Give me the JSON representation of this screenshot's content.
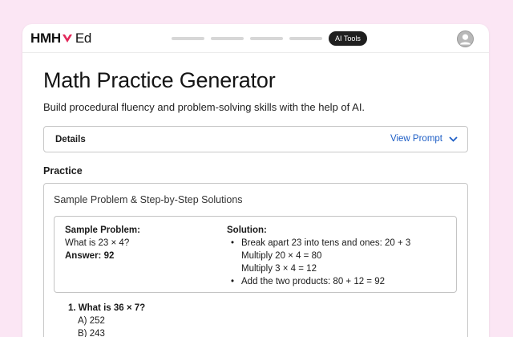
{
  "header": {
    "logo_text": "HMH",
    "logo_suffix": "Ed",
    "ai_tools_label": "AI Tools",
    "brand_color": "#e2285a"
  },
  "main": {
    "title": "Math Practice Generator",
    "subtitle": "Build procedural fluency and problem-solving skills with the help of AI.",
    "details": {
      "label": "Details",
      "view_prompt_label": "View Prompt"
    },
    "practice": {
      "section_title": "Practice",
      "heading": "Sample Problem & Step-by-Step Solutions",
      "sample": {
        "problem_label": "Sample Problem:",
        "problem_text": "What is 23 × 4?",
        "answer_label": "Answer: 92",
        "solution_label": "Solution:",
        "steps": [
          "Break apart 23 into tens and ones: 20 + 3",
          "Multiply 20 × 4 = 80",
          "Multiply 3 × 4 = 12",
          "Add the two products: 80 + 12 = 92"
        ]
      },
      "question": {
        "text": "1. What is 36 × 7?",
        "options": [
          "A) 252",
          "B) 243"
        ]
      }
    }
  }
}
